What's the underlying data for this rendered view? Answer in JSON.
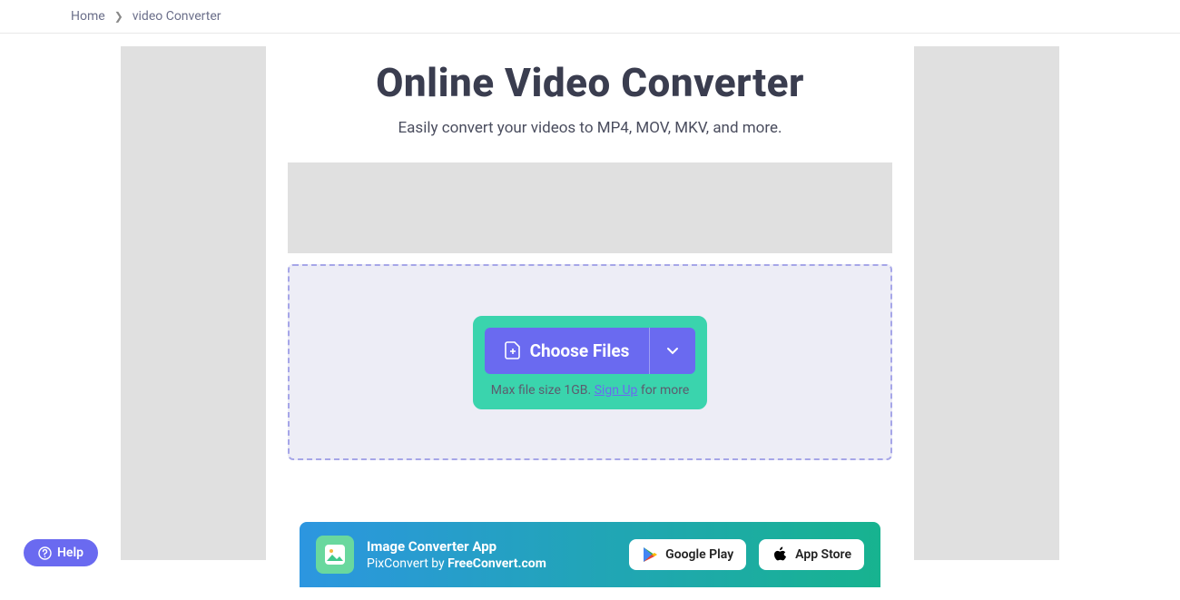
{
  "breadcrumb": {
    "home": "Home",
    "current": "video Converter"
  },
  "hero": {
    "title": "Online Video Converter",
    "subtitle": "Easily convert your videos to MP4, MOV, MKV, and more."
  },
  "upload": {
    "choose_label": "Choose Files",
    "max_prefix": "Max file size 1GB. ",
    "signup": "Sign Up",
    "max_suffix": " for more"
  },
  "promo": {
    "title": "Image Converter App",
    "subtitle_prefix": "PixConvert by ",
    "subtitle_brand": "FreeConvert.com",
    "google": "Google Play",
    "apple": "App Store"
  },
  "help": {
    "label": "Help"
  }
}
